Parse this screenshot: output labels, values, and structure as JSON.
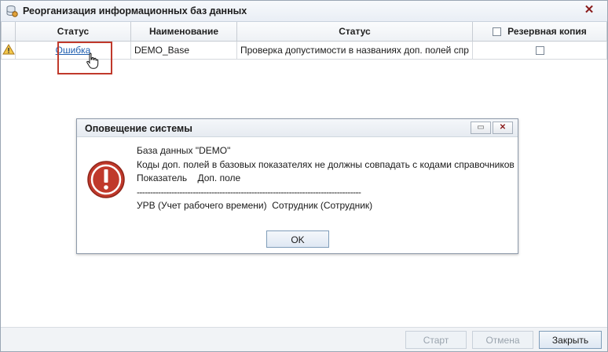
{
  "window": {
    "title": "Реорганизация информационных баз данных",
    "close_glyph": "✕"
  },
  "grid": {
    "headers": {
      "status": "Статус",
      "name": "Наименование",
      "status2": "Статус",
      "backup": "Резервная копия"
    },
    "rows": [
      {
        "status": "Ошибка",
        "name": "DEMO_Base",
        "check_status": "Проверка допустимости в названиях доп. полей спр",
        "backup_checked": false
      }
    ]
  },
  "dialog": {
    "title": "Оповещение системы",
    "lines": [
      "База данных \"DEMO\"",
      "Коды доп. полей в базовых показателях не должны совпадать с кодами справочников",
      "Показатель    Доп. поле",
      "------------------------------------------------------------------------------------",
      "УРВ (Учет рабочего времени)  Сотрудник (Сотрудник)"
    ],
    "ok_label": "OK"
  },
  "footer": {
    "start_label": "Старт",
    "cancel_label": "Отмена",
    "close_label": "Закрыть"
  },
  "colors": {
    "accent_red": "#c0392b",
    "link_blue": "#1f5fb0",
    "error_red": "#c0392b"
  }
}
